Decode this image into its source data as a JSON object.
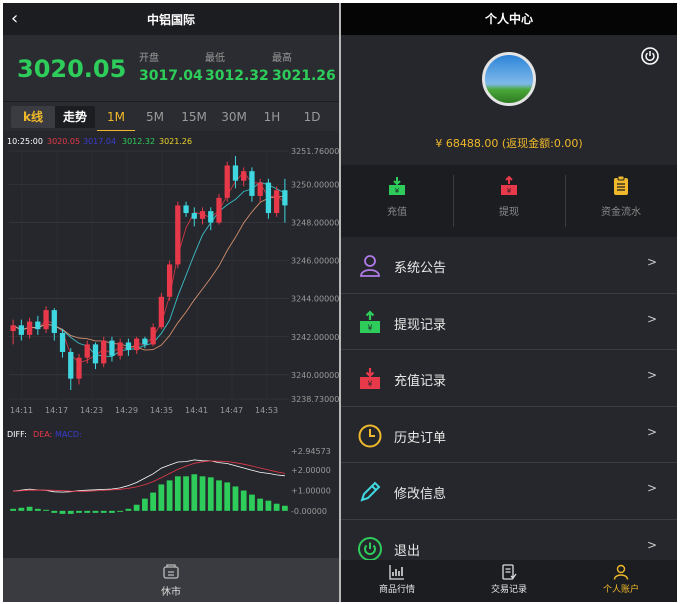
{
  "left": {
    "header": {
      "back_icon": "chevron-left-icon",
      "title": "中铝国际"
    },
    "quote": {
      "price": "3020.05",
      "open_label": "开盘",
      "open_value": "3017.04",
      "low_label": "最低",
      "low_value": "3012.32",
      "high_label": "最高",
      "high_value": "3021.26"
    },
    "tabs": [
      "k线",
      "走势",
      "1M",
      "5M",
      "15M",
      "30M",
      "1H",
      "1D"
    ],
    "active_tab": "1M",
    "chart_legend": {
      "time": "10:25:00",
      "v1": "3020.05",
      "v2": "3017.04",
      "v3": "3012.32",
      "v4": "3021.26"
    },
    "macd_legend": {
      "diff": "DIFF:",
      "dea": "DEA:",
      "macd": "MACD:"
    },
    "footer": {
      "label": "休市",
      "icon": "market-closed-icon"
    }
  },
  "right": {
    "header": {
      "title": "个人中心"
    },
    "power_icon": "power-icon",
    "balance": "¥ 68488.00 (返现金额:0.00)",
    "actions": [
      {
        "label": "充值",
        "icon": "deposit-icon",
        "color": "#2ecc5a"
      },
      {
        "label": "提现",
        "icon": "withdraw-icon",
        "color": "#e8394a"
      },
      {
        "label": "资金流水",
        "icon": "ledger-icon",
        "color": "#f0b92b"
      }
    ],
    "menu": [
      {
        "label": "系统公告",
        "icon": "user-icon",
        "arrow": ">"
      },
      {
        "label": "提现记录",
        "icon": "withdraw-record-icon",
        "arrow": ">"
      },
      {
        "label": "充值记录",
        "icon": "deposit-record-icon",
        "arrow": ">"
      },
      {
        "label": "历史订单",
        "icon": "clock-icon",
        "arrow": ">"
      },
      {
        "label": "修改信息",
        "icon": "edit-icon",
        "arrow": ">"
      },
      {
        "label": "退出",
        "icon": "power-off-icon",
        "arrow": ">"
      }
    ],
    "footer": [
      {
        "label": "商品行情",
        "icon": "market-chart-icon"
      },
      {
        "label": "交易记录",
        "icon": "trade-record-icon"
      },
      {
        "label": "个人账户",
        "icon": "account-icon",
        "active": true
      }
    ]
  },
  "chart_data": {
    "type": "candlestick",
    "x_ticks": [
      "14:11",
      "14:17",
      "14:23",
      "14:29",
      "14:35",
      "14:41",
      "14:47",
      "14:53"
    ],
    "y_ticks": [
      "3251.76000",
      "3250.00000",
      "3248.00000",
      "3246.00000",
      "3244.00000",
      "3242.00000",
      "3240.00000",
      "3238.73000"
    ],
    "ylim": [
      3238.73,
      3251.76
    ],
    "candles": [
      [
        3242.3,
        3242.6,
        3241.6,
        3242.9
      ],
      [
        3242.6,
        3242.1,
        3241.8,
        3242.9
      ],
      [
        3242.1,
        3242.8,
        3241.9,
        3243.0
      ],
      [
        3242.8,
        3242.4,
        3242.1,
        3243.1
      ],
      [
        3242.4,
        3243.4,
        3242.2,
        3243.6
      ],
      [
        3243.4,
        3242.2,
        3241.8,
        3243.5
      ],
      [
        3242.2,
        3241.2,
        3240.9,
        3242.4
      ],
      [
        3241.2,
        3239.8,
        3239.2,
        3241.4
      ],
      [
        3239.8,
        3240.9,
        3239.5,
        3241.1
      ],
      [
        3240.9,
        3241.6,
        3240.6,
        3241.8
      ],
      [
        3241.6,
        3240.6,
        3240.3,
        3241.7
      ],
      [
        3240.6,
        3241.8,
        3240.4,
        3242.0
      ],
      [
        3241.8,
        3241.0,
        3240.7,
        3242.0
      ],
      [
        3241.0,
        3241.7,
        3240.8,
        3241.9
      ],
      [
        3241.7,
        3241.3,
        3241.0,
        3241.9
      ],
      [
        3241.3,
        3241.9,
        3241.1,
        3242.0
      ],
      [
        3241.9,
        3241.6,
        3241.4,
        3242.0
      ],
      [
        3241.6,
        3242.5,
        3241.5,
        3242.7
      ],
      [
        3242.5,
        3244.1,
        3242.4,
        3244.3
      ],
      [
        3244.1,
        3245.8,
        3243.9,
        3246.0
      ],
      [
        3245.8,
        3248.9,
        3245.6,
        3249.1
      ],
      [
        3248.9,
        3248.5,
        3248.3,
        3249.1
      ],
      [
        3248.5,
        3248.2,
        3247.8,
        3248.8
      ],
      [
        3248.2,
        3248.6,
        3247.9,
        3248.8
      ],
      [
        3248.6,
        3248.0,
        3247.6,
        3248.8
      ],
      [
        3248.0,
        3249.3,
        3247.9,
        3249.5
      ],
      [
        3249.3,
        3251.0,
        3249.1,
        3251.2
      ],
      [
        3251.0,
        3250.2,
        3249.8,
        3251.5
      ],
      [
        3250.2,
        3250.7,
        3249.9,
        3250.9
      ],
      [
        3250.7,
        3249.4,
        3249.1,
        3250.9
      ],
      [
        3249.4,
        3250.1,
        3249.1,
        3250.3
      ],
      [
        3250.1,
        3248.5,
        3248.2,
        3250.3
      ],
      [
        3248.5,
        3249.7,
        3248.3,
        3249.9
      ],
      [
        3249.7,
        3248.9,
        3248.0,
        3250.3
      ]
    ],
    "macd_ticks": [
      "+2.94573",
      "+2.00000",
      "+1.00000",
      "-0.00000"
    ],
    "macd_ylim": [
      -0.5,
      2.94573
    ],
    "macd_hist": [
      0.1,
      0.15,
      0.2,
      0.1,
      0.05,
      -0.1,
      -0.15,
      -0.15,
      -0.1,
      -0.1,
      -0.1,
      -0.1,
      -0.1,
      -0.05,
      0.1,
      0.3,
      0.6,
      0.9,
      1.3,
      1.5,
      1.7,
      1.7,
      1.8,
      1.7,
      1.65,
      1.5,
      1.4,
      1.2,
      1.0,
      0.8,
      0.6,
      0.5,
      0.35,
      0.25
    ],
    "colors": {
      "up": "#e8394a",
      "down": "#3fd7e0",
      "hist": "#2ecc5a"
    }
  }
}
